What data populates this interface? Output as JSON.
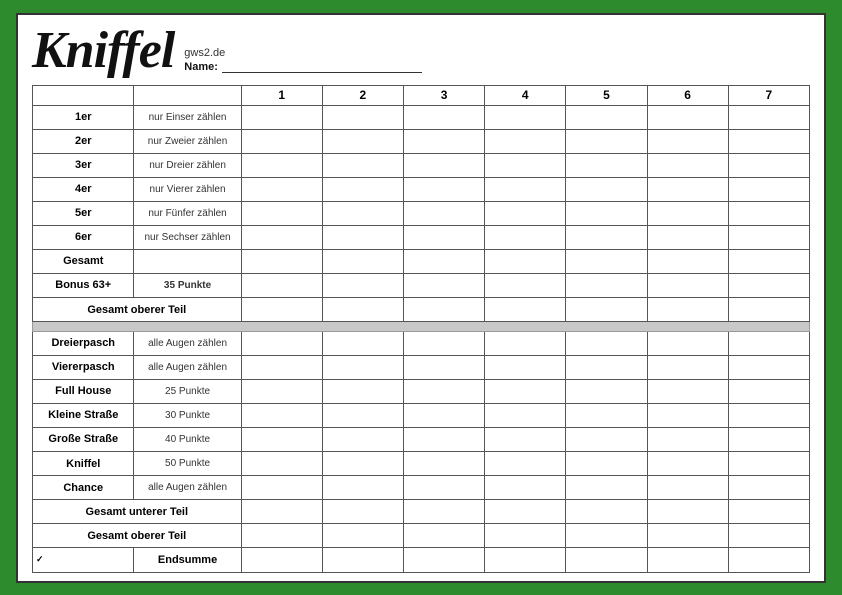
{
  "header": {
    "title": "Kniffel",
    "subtitle": "gws2.de",
    "name_label": "Name:"
  },
  "columns": [
    "1",
    "2",
    "3",
    "4",
    "5",
    "6",
    "7"
  ],
  "upper_section": [
    {
      "label": "1er",
      "desc": "nur Einser zählen"
    },
    {
      "label": "2er",
      "desc": "nur Zweier zählen"
    },
    {
      "label": "3er",
      "desc": "nur Dreier zählen"
    },
    {
      "label": "4er",
      "desc": "nur Vierer zählen"
    },
    {
      "label": "5er",
      "desc": "nur Fünfer zählen"
    },
    {
      "label": "6er",
      "desc": "nur Sechser zählen"
    },
    {
      "label": "Gesamt",
      "desc": ""
    },
    {
      "label": "Bonus 63+",
      "desc": "35 Punkte"
    },
    {
      "label": "Gesamt oberer Teil",
      "desc": ""
    }
  ],
  "lower_section": [
    {
      "label": "Dreierpasch",
      "desc": "alle Augen zählen"
    },
    {
      "label": "Viererpasch",
      "desc": "alle Augen zählen"
    },
    {
      "label": "Full House",
      "desc": "25 Punkte"
    },
    {
      "label": "Kleine Straße",
      "desc": "30 Punkte"
    },
    {
      "label": "Große Straße",
      "desc": "40 Punkte"
    },
    {
      "label": "Kniffel",
      "desc": "50 Punkte"
    },
    {
      "label": "Chance",
      "desc": "alle Augen zählen"
    },
    {
      "label": "Gesamt unterer Teil",
      "desc": ""
    },
    {
      "label": "Gesamt oberer Teil",
      "desc": ""
    },
    {
      "label": "Endsumme",
      "desc": "",
      "checkmark": true
    }
  ]
}
